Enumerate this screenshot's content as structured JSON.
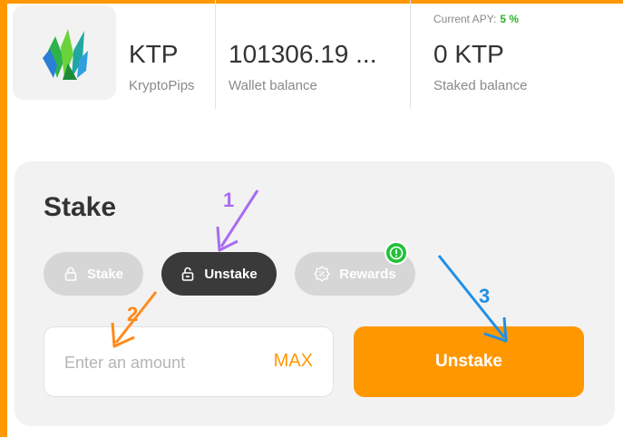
{
  "token": {
    "symbol": "KTP",
    "name": "KryptoPips",
    "logo_icon": "green-crystal-icon"
  },
  "wallet": {
    "value": "101306.19 ...",
    "label": "Wallet balance"
  },
  "staked": {
    "value": "0 KTP",
    "label": "Staked balance",
    "apy_label": "Current APY:",
    "apy_value": "5 %"
  },
  "card": {
    "title": "Stake",
    "tabs": [
      {
        "label": "Stake",
        "icon": "lock-icon",
        "active": false
      },
      {
        "label": "Unstake",
        "icon": "unlock-icon",
        "active": true
      },
      {
        "label": "Rewards",
        "icon": "badge-percent-icon",
        "active": false
      }
    ],
    "rewards_badge_icon": "alert-icon",
    "amount_placeholder": "Enter an amount",
    "max_label": "MAX",
    "submit_label": "Unstake"
  },
  "annotations": {
    "step1": "1",
    "step2": "2",
    "step3": "3"
  },
  "colors": {
    "accent": "#ff9800",
    "active_tab": "#3a3a3a",
    "inactive_tab": "#d6d6d6",
    "apy_green": "#2db22d",
    "badge_green": "#22c13a",
    "annot_purple": "#a66cf0",
    "annot_orange": "#ff8a1c",
    "annot_blue": "#1e8fe6"
  }
}
